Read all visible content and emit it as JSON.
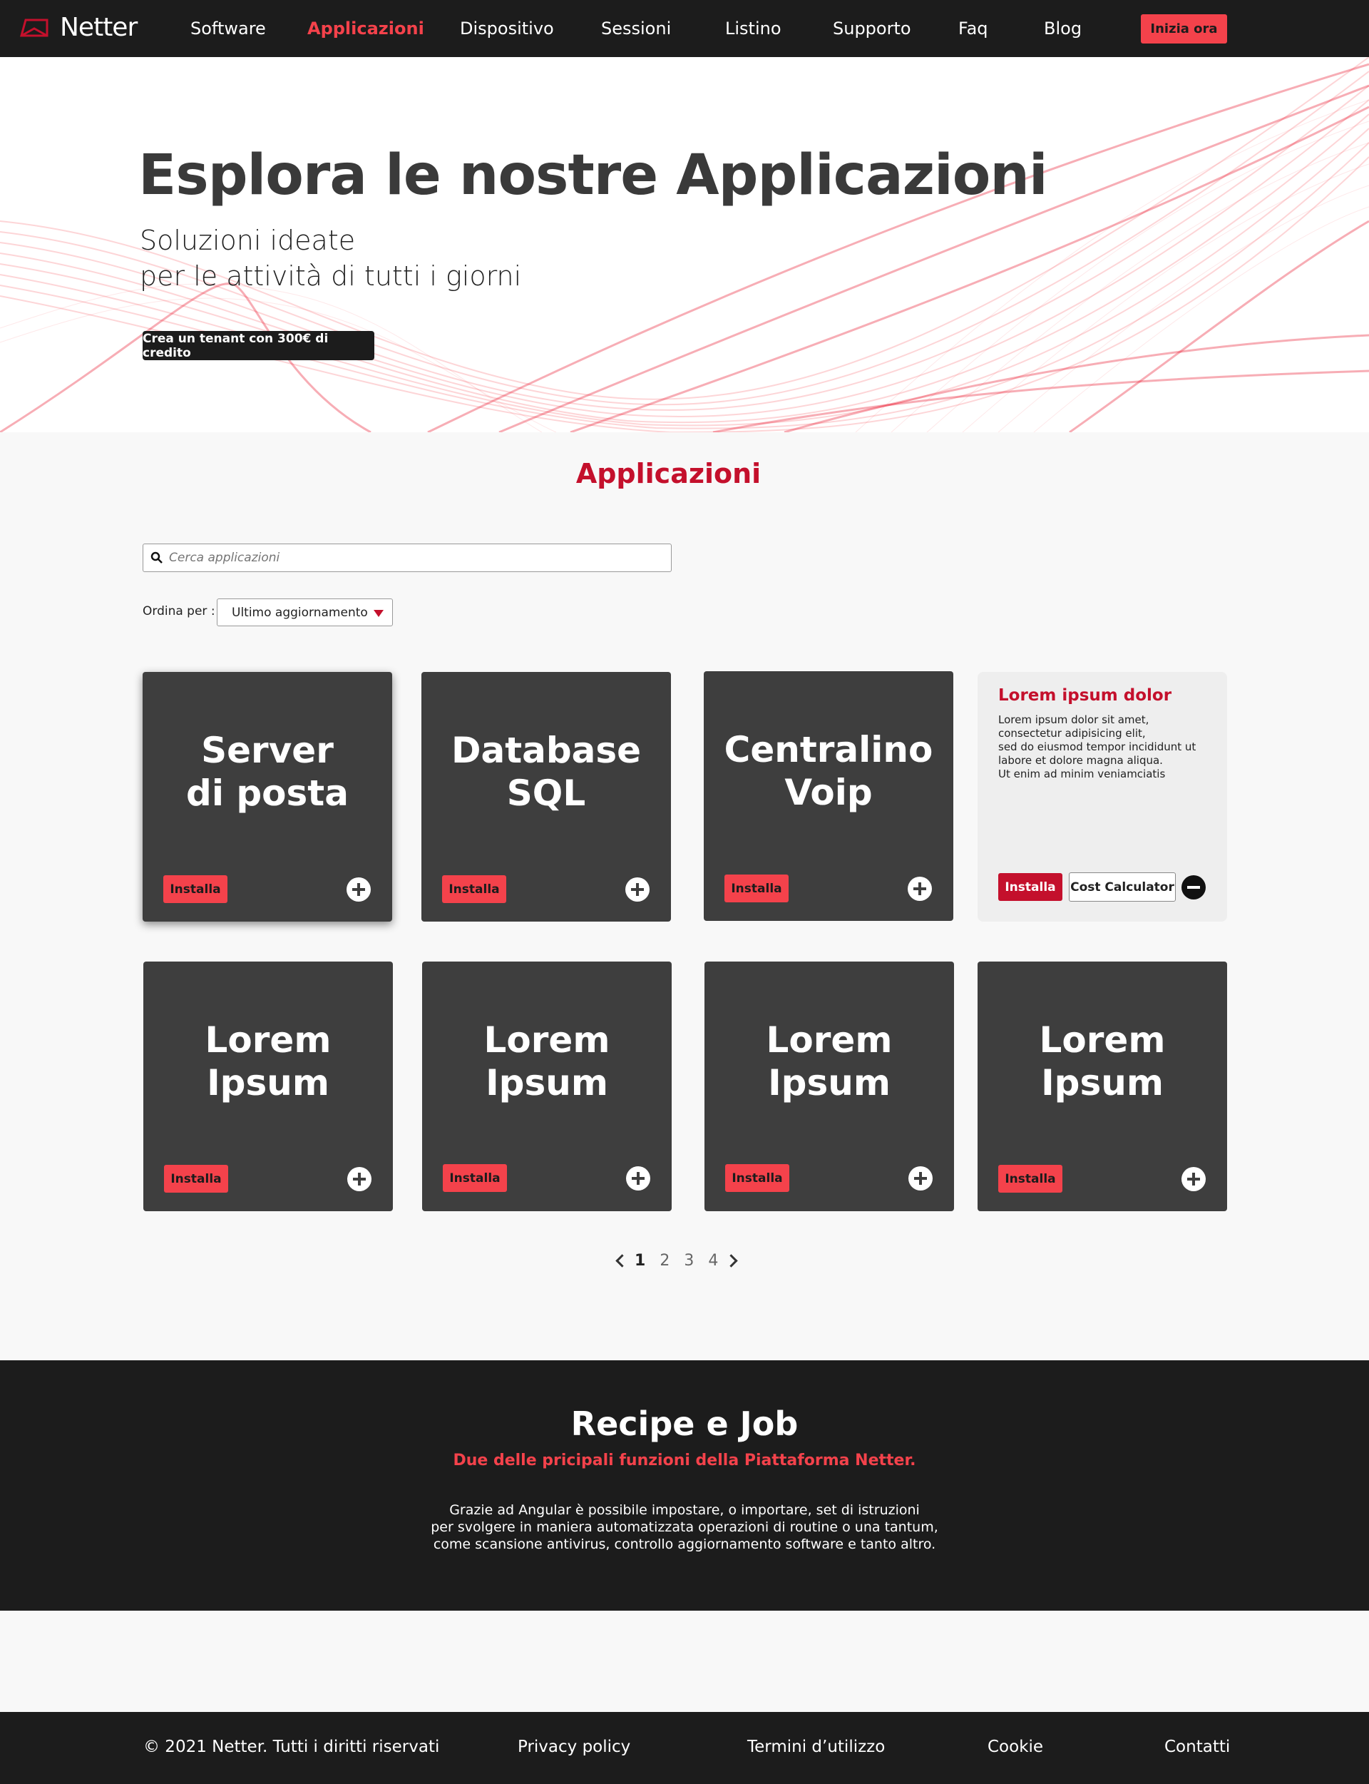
{
  "brand": {
    "name": "Netter"
  },
  "nav": {
    "items": [
      {
        "label": "Software"
      },
      {
        "label": "Applicazioni"
      },
      {
        "label": "Dispositivo"
      },
      {
        "label": "Sessioni"
      },
      {
        "label": "Listino"
      },
      {
        "label": "Supporto"
      },
      {
        "label": "Faq"
      },
      {
        "label": "Blog"
      }
    ],
    "active": "Applicazioni",
    "cta": "Inizia ora"
  },
  "hero": {
    "title": "Esplora le nostre Applicazioni",
    "subtitle_line1": "Soluzioni ideate",
    "subtitle_line2": "per le attività di tutti i giorni",
    "button": "Crea un tenant con 300€ di credito"
  },
  "section": {
    "title": "Applicazioni",
    "search_placeholder": "Cerca applicazioni",
    "sort_label": "Ordina per :",
    "sort_value": "Ultimo aggiornamento"
  },
  "cards": [
    {
      "title_line1": "Server",
      "title_line2": "di posta",
      "install": "Installa"
    },
    {
      "title_line1": "Database",
      "title_line2": "SQL",
      "install": "Installa"
    },
    {
      "title_line1": "Centralino",
      "title_line2": "Voip",
      "install": "Installa"
    },
    {
      "title_line1": "Lorem",
      "title_line2": "Ipsum",
      "install": "Installa"
    },
    {
      "title_line1": "Lorem",
      "title_line2": "Ipsum",
      "install": "Installa"
    },
    {
      "title_line1": "Lorem",
      "title_line2": "Ipsum",
      "install": "Installa"
    },
    {
      "title_line1": "Lorem",
      "title_line2": "Ipsum",
      "install": "Installa"
    }
  ],
  "info_card": {
    "title": "Lorem ipsum dolor",
    "lines": [
      "Lorem ipsum dolor sit amet,",
      "consectetur adipisicing elit,",
      "sed do eiusmod tempor incididunt ut",
      "labore et dolore magna aliqua.",
      "Ut enim ad minim veniamciatis"
    ],
    "install": "Installa",
    "cost_calculator": "Cost Calculator"
  },
  "pagination": {
    "pages": [
      "1",
      "2",
      "3",
      "4"
    ],
    "current": "1"
  },
  "recipe": {
    "title": "Recipe e Job",
    "subtitle": "Due delle pricipali funzioni della Piattaforma Netter.",
    "lines": [
      "Grazie ad Angular è possibile impostare, o importare, set di istruzioni",
      "per svolgere in maniera automatizzata operazioni di routine o una tantum,",
      "come scansione antivirus, controllo aggiornamento software e tanto altro."
    ]
  },
  "footer": {
    "copyright": "© 2021 Netter. Tutti i diritti riservati",
    "privacy": "Privacy policy",
    "terms": "Termini d’utilizzo",
    "cookie": "Cookie",
    "contacts": "Contatti"
  },
  "colors": {
    "accent": "#f4424b",
    "brand_red": "#c4102c",
    "dark": "#1c1c1c",
    "card": "#3e3e3e"
  }
}
